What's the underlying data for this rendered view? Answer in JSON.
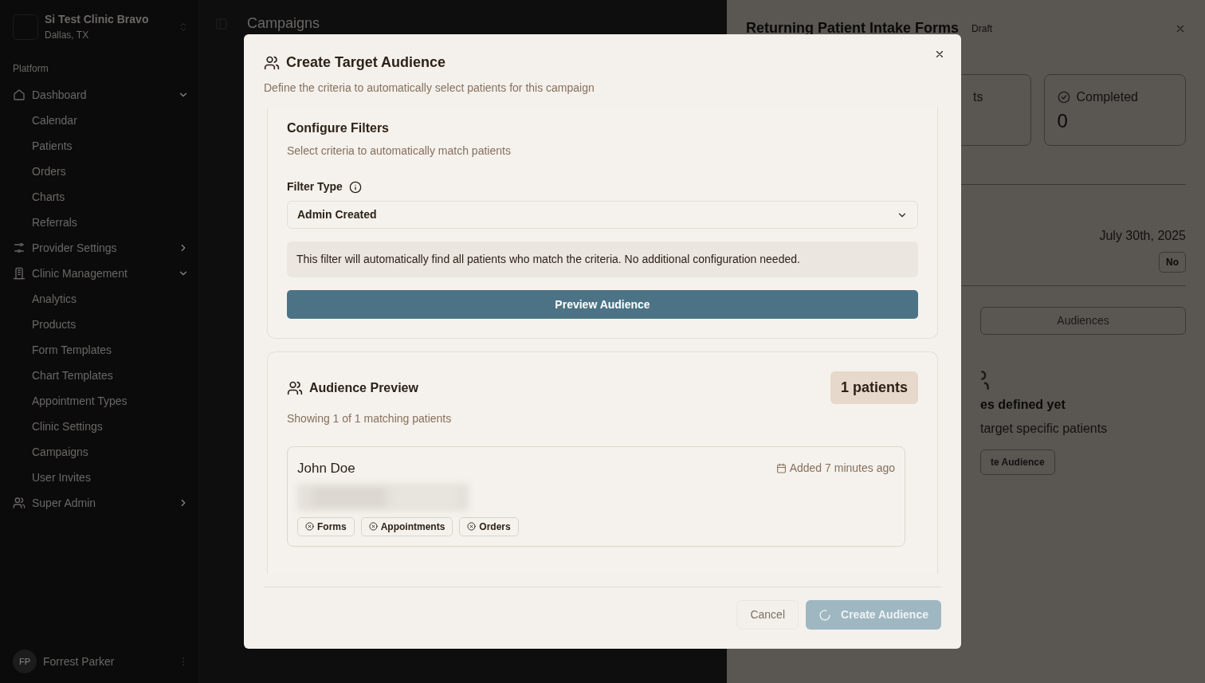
{
  "sidebar": {
    "clinic": {
      "name": "Si Test Clinic Bravo",
      "location": "Dallas, TX"
    },
    "section_label": "Platform",
    "items": [
      {
        "label": "Dashboard",
        "expanded": true,
        "children": [
          {
            "label": "Calendar"
          },
          {
            "label": "Patients"
          },
          {
            "label": "Orders"
          },
          {
            "label": "Charts"
          },
          {
            "label": "Referrals"
          }
        ]
      },
      {
        "label": "Provider Settings",
        "expanded": false
      },
      {
        "label": "Clinic Management",
        "expanded": true,
        "children": [
          {
            "label": "Analytics"
          },
          {
            "label": "Products"
          },
          {
            "label": "Form Templates"
          },
          {
            "label": "Chart Templates"
          },
          {
            "label": "Appointment Types"
          },
          {
            "label": "Clinic Settings"
          },
          {
            "label": "Campaigns"
          },
          {
            "label": "User Invites"
          }
        ]
      },
      {
        "label": "Super Admin",
        "expanded": false
      }
    ],
    "user": {
      "initials": "FP",
      "name": "Forrest Parker"
    }
  },
  "main": {
    "title": "Campaigns"
  },
  "detail_panel": {
    "title": "Returning Patient Intake Forms",
    "status": "Draft",
    "stats": [
      {
        "label": "ts"
      },
      {
        "label": "Completed",
        "value": "0"
      }
    ],
    "date": "July 30th, 2025",
    "flag": "No",
    "tab": "Audiences",
    "empty_title": "es defined yet",
    "empty_text": "target specific patients",
    "action": "te Audience"
  },
  "modal": {
    "title": "Create Target Audience",
    "subtitle": "Define the criteria to automatically select patients for this campaign",
    "filters": {
      "title": "Configure Filters",
      "subtitle": "Select criteria to automatically match patients",
      "field_label": "Filter Type",
      "select_value": "Admin Created",
      "info": "This filter will automatically find all patients who match the criteria. No additional configuration needed.",
      "preview_button": "Preview Audience"
    },
    "preview": {
      "title": "Audience Preview",
      "count": "1 patients",
      "subtitle": "Showing 1 of 1 matching patients",
      "patients": [
        {
          "name": "John Doe",
          "added": "Added 7 minutes ago",
          "tags": [
            "Forms",
            "Appointments",
            "Orders"
          ]
        }
      ]
    },
    "cancel_button": "Cancel",
    "create_button": {
      "label": "Create Audience",
      "loading": true,
      "disabled": true
    }
  }
}
